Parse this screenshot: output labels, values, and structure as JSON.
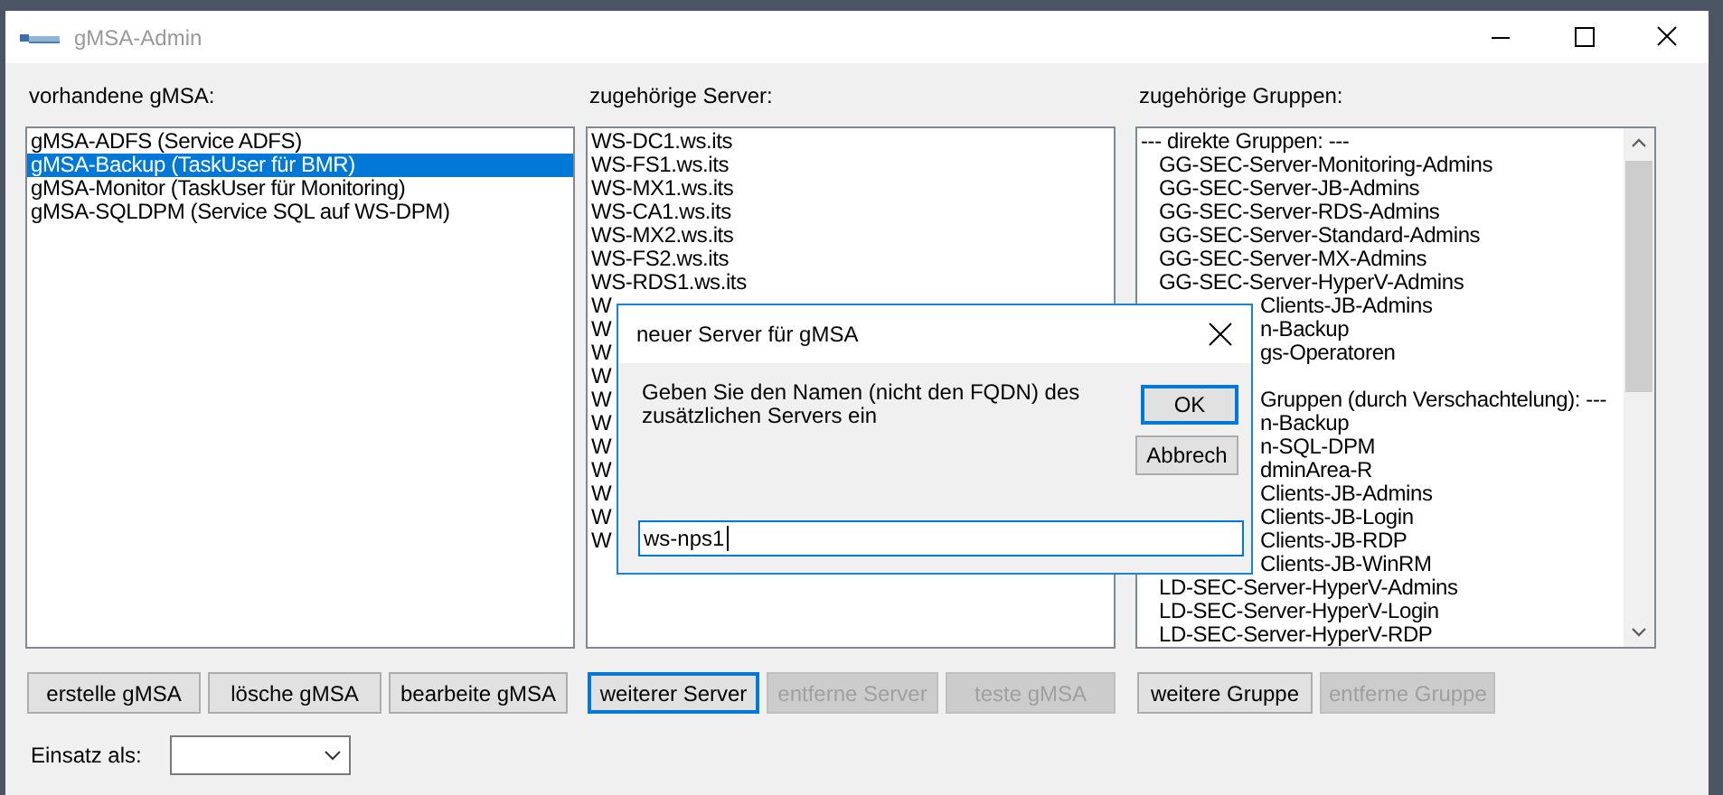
{
  "window": {
    "title": "gMSA-Admin"
  },
  "columns": [
    {
      "label": "vorhandene gMSA:",
      "items": [
        {
          "text": "gMSA-ADFS (Service ADFS)",
          "kind": "item",
          "selected": false
        },
        {
          "text": "gMSA-Backup (TaskUser für BMR)",
          "kind": "item",
          "selected": true
        },
        {
          "text": "gMSA-Monitor (TaskUser für Monitoring)",
          "kind": "item",
          "selected": false
        },
        {
          "text": "gMSA-SQLDPM (Service SQL auf WS-DPM)",
          "kind": "item",
          "selected": false
        }
      ],
      "buttons": [
        {
          "label": "erstelle gMSA",
          "disabled": false,
          "focused": false
        },
        {
          "label": "lösche gMSA",
          "disabled": false,
          "focused": false
        },
        {
          "label": "bearbeite gMSA",
          "disabled": false,
          "focused": false
        }
      ]
    },
    {
      "label": "zugehörige Server:",
      "items": [
        {
          "text": "WS-DC1.ws.its",
          "kind": "item"
        },
        {
          "text": "WS-FS1.ws.its",
          "kind": "item"
        },
        {
          "text": "WS-MX1.ws.its",
          "kind": "item"
        },
        {
          "text": "WS-CA1.ws.its",
          "kind": "item"
        },
        {
          "text": "WS-MX2.ws.its",
          "kind": "item"
        },
        {
          "text": "WS-FS2.ws.its",
          "kind": "item"
        },
        {
          "text": "WS-RDS1.ws.its",
          "kind": "item"
        },
        {
          "text": "W",
          "kind": "item"
        },
        {
          "text": "W",
          "kind": "item"
        },
        {
          "text": "W",
          "kind": "item"
        },
        {
          "text": "W",
          "kind": "item"
        },
        {
          "text": "W",
          "kind": "item"
        },
        {
          "text": "W",
          "kind": "item"
        },
        {
          "text": "W",
          "kind": "item"
        },
        {
          "text": "W",
          "kind": "item"
        },
        {
          "text": "W",
          "kind": "item"
        },
        {
          "text": "W",
          "kind": "item"
        },
        {
          "text": "W",
          "kind": "item"
        }
      ],
      "buttons": [
        {
          "label": "weiterer Server",
          "disabled": false,
          "focused": true
        },
        {
          "label": "entferne Server",
          "disabled": true,
          "focused": false
        },
        {
          "label": "teste gMSA",
          "disabled": true,
          "focused": false
        }
      ]
    },
    {
      "label": "zugehörige Gruppen:",
      "items": [
        {
          "text": "--- direkte Gruppen: ---",
          "kind": "header"
        },
        {
          "text": "GG-SEC-Server-Monitoring-Admins",
          "kind": "subitem"
        },
        {
          "text": "GG-SEC-Server-JB-Admins",
          "kind": "subitem"
        },
        {
          "text": "GG-SEC-Server-RDS-Admins",
          "kind": "subitem"
        },
        {
          "text": "GG-SEC-Server-Standard-Admins",
          "kind": "subitem"
        },
        {
          "text": "GG-SEC-Server-MX-Admins",
          "kind": "subitem"
        },
        {
          "text": "GG-SEC-Server-HyperV-Admins",
          "kind": "subitem"
        },
        {
          "text": "Clients-JB-Admins",
          "kind": "covered"
        },
        {
          "text": "n-Backup",
          "kind": "covered"
        },
        {
          "text": "gs-Operatoren",
          "kind": "covered"
        },
        {
          "kind": "gap"
        },
        {
          "text": "Gruppen (durch Verschachtelung): ---",
          "kind": "covered"
        },
        {
          "text": "n-Backup",
          "kind": "covered"
        },
        {
          "text": "n-SQL-DPM",
          "kind": "covered"
        },
        {
          "text": "dminArea-R",
          "kind": "covered"
        },
        {
          "text": "Clients-JB-Admins",
          "kind": "covered"
        },
        {
          "text": "Clients-JB-Login",
          "kind": "covered"
        },
        {
          "text": "Clients-JB-RDP",
          "kind": "covered"
        },
        {
          "text": "Clients-JB-WinRM",
          "kind": "covered"
        },
        {
          "text": "LD-SEC-Server-HyperV-Admins",
          "kind": "subitem"
        },
        {
          "text": "LD-SEC-Server-HyperV-Login",
          "kind": "subitem"
        },
        {
          "text": "LD-SEC-Server-HyperV-RDP",
          "kind": "subitem"
        }
      ],
      "scrollbar": true,
      "buttons": [
        {
          "label": "weitere Gruppe",
          "disabled": false,
          "focused": false
        },
        {
          "label": "entferne Gruppe",
          "disabled": true,
          "focused": false
        }
      ]
    }
  ],
  "usage": {
    "label": "Einsatz als:"
  },
  "dialog": {
    "title": "neuer Server für gMSA",
    "message": "Geben Sie den Namen (nicht den FQDN) des zusätzlichen Servers ein",
    "buttons": [
      {
        "label": "OK",
        "default": true
      },
      {
        "label": "Abbrech",
        "default": false
      }
    ],
    "input": {
      "value": "ws-nps1"
    }
  }
}
